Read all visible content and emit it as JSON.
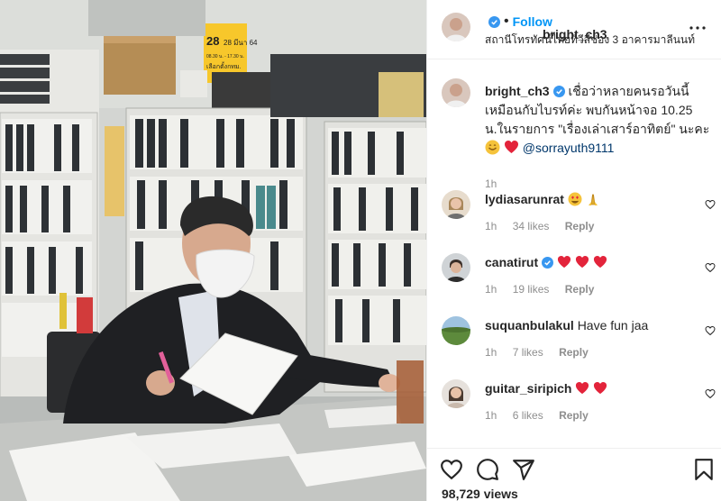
{
  "header": {
    "username": "bright_ch3",
    "follow_label": "Follow",
    "location": "สถานีโทรทัศน์ไทยทีวีสีช่อง 3 อาคารมาลีนนท์"
  },
  "caption": {
    "username": "bright_ch3",
    "text_main": "เชื่อว่าหลายคนรอวันนี้เหมือนกับไบรท์ค่ะ พบกันหน้าจอ 10.25 น.ในรายการ \"เรื่องเล่าเสาร์อาทิตย์\" นะคะ",
    "mention": "@sorrayuth9111",
    "time": "1h"
  },
  "comments": [
    {
      "username": "lydiasarunrat",
      "text": "",
      "time": "1h",
      "likes": "34 likes",
      "reply": "Reply"
    },
    {
      "username": "canatirut",
      "text": "",
      "time": "1h",
      "likes": "19 likes",
      "reply": "Reply"
    },
    {
      "username": "suquanbulakul",
      "text": "Have fun jaa",
      "time": "1h",
      "likes": "7 likes",
      "reply": "Reply"
    },
    {
      "username": "guitar_siripich",
      "text": "",
      "time": "1h",
      "likes": "6 likes",
      "reply": "Reply"
    }
  ],
  "photo_sign": {
    "line1": "28 มีนา 64",
    "line2": "08.30 น. - 17.30 น.",
    "line3": "เลือกตั้งกทม."
  },
  "stats": {
    "views": "98,729 views"
  },
  "colors": {
    "accent": "#0095f6",
    "heart_red": "#ed4956",
    "verified": "#3897f0"
  },
  "icons": [
    "verified-badge-icon",
    "more-options-icon",
    "heart-icon",
    "comment-icon",
    "share-icon",
    "bookmark-icon"
  ]
}
